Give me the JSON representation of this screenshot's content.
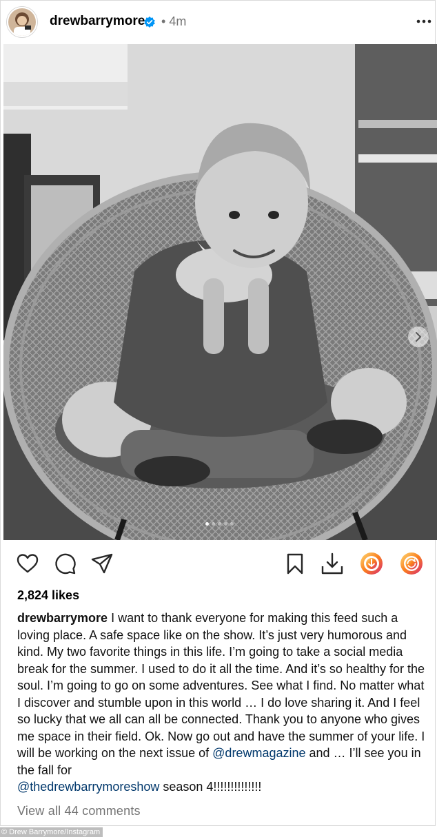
{
  "post": {
    "username": "drewbarrymore",
    "verified": true,
    "separator": "•",
    "time_ago": "4m",
    "likes": "2,824 likes",
    "caption_user": "drewbarrymore",
    "caption_part1": " I want to thank everyone for making this feed such a loving place. A safe space like on the show. It’s just very humorous and kind. My two favorite things in this life. I’m going to take a social media break for the summer. I used to do it all the time. And it’s so healthy for the soul. I’m going to go on some adventures. See what I find. No matter what I discover and stumble upon in this world … I do love sharing it. And I feel so lucky that we all can all be connected. Thank you to anyone who gives me space in their field. Ok. Now go out and have the summer of your life. I will be working on the next issue of ",
    "mention1": "@drewmagazine",
    "caption_part2": " and … I’ll see you in the fall for\n",
    "mention2": "@thedrewbarrymoreshow",
    "caption_part3": " season 4!!!!!!!!!!!!!!",
    "view_comments": "View all 44 comments",
    "carousel": {
      "total": 5,
      "active_index": 0
    }
  },
  "credit": "© Drew Barrymore/Instagram",
  "icons": {
    "verified": "verified-badge-icon",
    "more": "more-options-icon",
    "like": "heart-icon",
    "comment": "comment-icon",
    "share": "send-icon",
    "save": "bookmark-icon",
    "download": "download-icon",
    "download_app": "download-circle-icon",
    "repost": "repost-icon"
  },
  "colors": {
    "verified_blue": "#0095f6",
    "mention": "#00376b",
    "muted": "#737373",
    "gradient_start": "#feda75",
    "gradient_end": "#d62976"
  }
}
